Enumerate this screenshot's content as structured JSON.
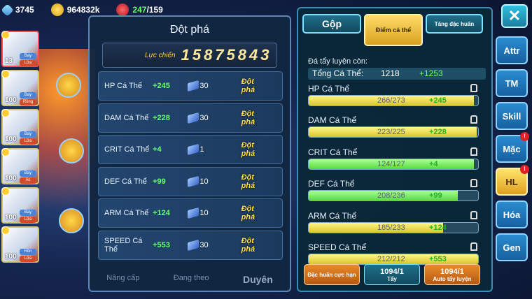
{
  "topbar": {
    "gems": "3745",
    "coins": "964832k",
    "stamina_current": "247",
    "stamina_max": "/159"
  },
  "heroes": [
    {
      "level": "13",
      "types": [
        "Bay",
        "Lửa"
      ]
    },
    {
      "level": "100",
      "types": [
        "Bay",
        "Rồng"
      ]
    },
    {
      "level": "100",
      "types": [
        "Bay",
        "Lửa"
      ]
    },
    {
      "level": "100",
      "types": [
        "Bay",
        "Ác"
      ]
    },
    {
      "level": "100",
      "types": [
        "Bay",
        "Lửa"
      ]
    },
    {
      "level": "100",
      "types": [
        "Hồn",
        "Lửa"
      ]
    }
  ],
  "breakthrough": {
    "title": "Đột phá",
    "power_label": "Lực chiến",
    "power_value": "15875843",
    "button_label": "Đột phá",
    "rows": [
      {
        "name": "HP Cá Thể",
        "bonus": "+245",
        "cost": "30"
      },
      {
        "name": "DAM Cá Thể",
        "bonus": "+228",
        "cost": "30"
      },
      {
        "name": "CRIT Cá Thể",
        "bonus": "+4",
        "cost": "1"
      },
      {
        "name": "DEF Cá Thể",
        "bonus": "+99",
        "cost": "10"
      },
      {
        "name": "ARM Cá Thể",
        "bonus": "+124",
        "cost": "10"
      },
      {
        "name": "SPEED Cá Thể",
        "bonus": "+553",
        "cost": "30"
      }
    ],
    "bottom_tabs": [
      "Nâng cấp",
      "Đang theo",
      "Duyên"
    ]
  },
  "stats_panel": {
    "tabs": [
      "Gộp",
      "Điểm cá thể",
      "Tăng đặc huấn"
    ],
    "remaining_label": "Đá tẩy luyện còn:",
    "total_label": "Tổng Cá Thể:",
    "total_value": "1218",
    "total_bonus": "+1253",
    "stats": [
      {
        "name": "HP Cá Thể",
        "value": "266/273",
        "bonus": "+245",
        "fill": 0.974,
        "color": "yellow"
      },
      {
        "name": "DAM Cá Thể",
        "value": "223/225",
        "bonus": "+228",
        "fill": 0.991,
        "color": "yellow"
      },
      {
        "name": "CRIT Cá Thể",
        "value": "124/127",
        "bonus": "+4",
        "fill": 0.976,
        "color": "green"
      },
      {
        "name": "DEF Cá Thể",
        "value": "208/236",
        "bonus": "+99",
        "fill": 0.881,
        "color": "green"
      },
      {
        "name": "ARM Cá Thể",
        "value": "185/233",
        "bonus": "+124",
        "fill": 0.794,
        "color": "yellow"
      },
      {
        "name": "SPEED Cá Thể",
        "value": "212/212",
        "bonus": "+553",
        "fill": 1.0,
        "color": "yellow"
      }
    ],
    "bottom_buttons": [
      {
        "label": "Đặc huấn cực hạn",
        "count": ""
      },
      {
        "label": "Tẩy",
        "count": "1094/1"
      },
      {
        "label": "Auto tẩy luyện",
        "count": "1094/1"
      }
    ]
  },
  "side_buttons": [
    {
      "label": "Attr",
      "badge": false
    },
    {
      "label": "TM",
      "badge": false
    },
    {
      "label": "Skill",
      "badge": false
    },
    {
      "label": "Mặc",
      "badge": true
    },
    {
      "label": "HL",
      "badge": true,
      "active": true
    },
    {
      "label": "Hóa",
      "badge": false
    },
    {
      "label": "Gen",
      "badge": false
    }
  ],
  "close_label": "✕",
  "badge_text": "!"
}
